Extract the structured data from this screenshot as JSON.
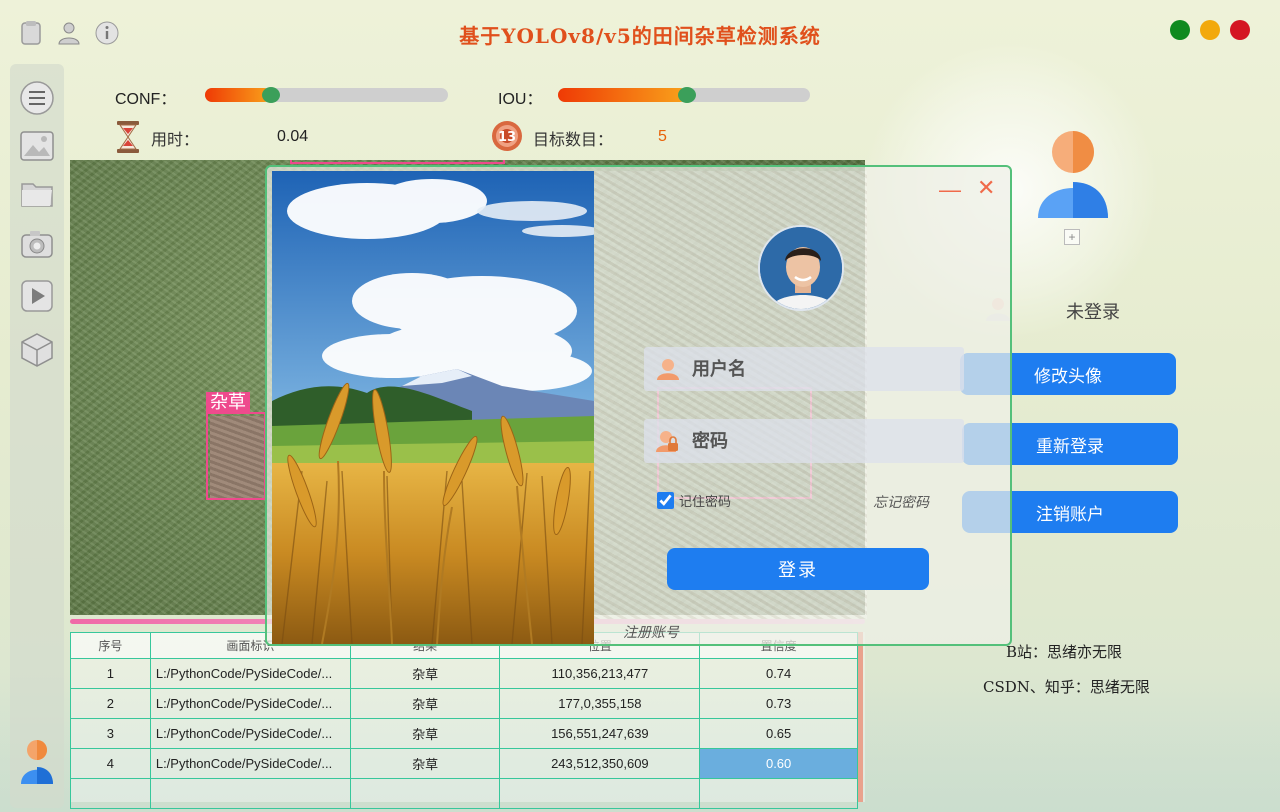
{
  "app": {
    "title": "基于YOLOv8/v5的田间杂草检测系统"
  },
  "colors": {
    "accent": "#1e7df0",
    "title": "#e0501c",
    "win_green": "#0f8a1f",
    "win_yellow": "#f2a90c",
    "win_red": "#d41622",
    "table_border": "#37c79b",
    "detect_box": "#ee4a8d"
  },
  "toolbar": {
    "icons": [
      "clipboard-icon",
      "user-icon",
      "info-icon"
    ]
  },
  "sidebar": {
    "items": [
      "menu-icon",
      "image-icon",
      "folder-icon",
      "camera-icon",
      "video-icon",
      "model-icon"
    ]
  },
  "controls": {
    "conf_label": "CONF：",
    "conf_value": 0.27,
    "iou_label": "IOU：",
    "iou_value": 0.51
  },
  "stats": {
    "time_label": "用时：",
    "time_value": "0.04",
    "count_label": "目标数目：",
    "count_value": "5"
  },
  "viewer": {
    "detection_label": "杂草"
  },
  "table": {
    "headers": [
      "序号",
      "画面标识",
      "结果",
      "位置",
      "置信度"
    ],
    "rows": [
      [
        "1",
        "L:/PythonCode/PySideCode/...",
        "杂草",
        "110,356,213,477",
        "0.74"
      ],
      [
        "2",
        "L:/PythonCode/PySideCode/...",
        "杂草",
        "177,0,355,158",
        "0.73"
      ],
      [
        "3",
        "L:/PythonCode/PySideCode/...",
        "杂草",
        "156,551,247,639",
        "0.65"
      ],
      [
        "4",
        "L:/PythonCode/PySideCode/...",
        "杂草",
        "243,512,350,609",
        "0.60"
      ]
    ]
  },
  "right_panel": {
    "avatar_add": "+",
    "status": "未登录",
    "btn_change_avatar": "修改头像",
    "btn_relogin": "重新登录",
    "btn_delete": "注销账户",
    "credit_bilibili": "B站：思绪亦无限",
    "credit_csdn": "CSDN、知乎：思绪无限"
  },
  "login": {
    "minimize": "—",
    "close": "✕",
    "username_placeholder": "用户名",
    "password_placeholder": "密码",
    "remember": "记住密码",
    "forgot": "忘记密码",
    "login_btn": "登录",
    "register": "注册账号"
  }
}
